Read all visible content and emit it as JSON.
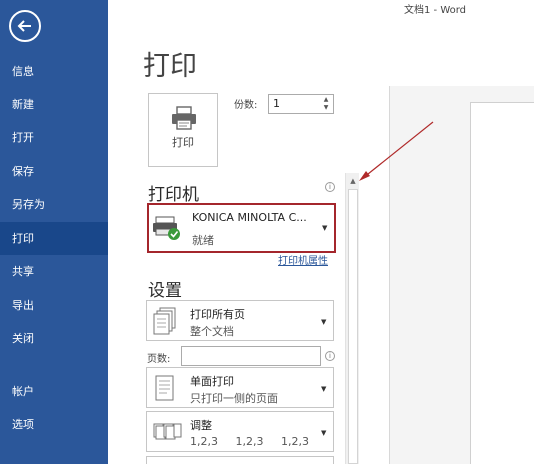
{
  "window": {
    "title": "文档1 - Word"
  },
  "sidebar": {
    "items": [
      {
        "label": "信息"
      },
      {
        "label": "新建"
      },
      {
        "label": "打开"
      },
      {
        "label": "保存"
      },
      {
        "label": "另存为"
      },
      {
        "label": "打印"
      },
      {
        "label": "共享"
      },
      {
        "label": "导出"
      },
      {
        "label": "关闭"
      },
      {
        "label": "帐户"
      },
      {
        "label": "选项"
      }
    ],
    "active": "打印",
    "color": "#2b579a"
  },
  "main": {
    "title": "打印",
    "print_button": {
      "label": "打印",
      "icon": "printer-icon"
    },
    "copies": {
      "label": "份数:",
      "value": "1"
    },
    "printer_section": {
      "heading": "打印机",
      "selected_name": "KONICA MINOLTA C...",
      "status": "就绪",
      "properties_link": "打印机属性",
      "highlight_color": "#a4262c"
    },
    "settings_section": {
      "heading": "设置",
      "range": {
        "main": "打印所有页",
        "sub": "整个文档"
      },
      "pages_label": "页数:",
      "pages_value": "",
      "sides": {
        "main": "单面打印",
        "sub": "只打印一侧的页面"
      },
      "collate": {
        "main": "调整",
        "sub": "1,2,3 1,2,3 1,2,3"
      }
    }
  },
  "icons": {
    "info": "i",
    "dropdown": "▼",
    "spin_up": "▲",
    "spin_down": "▼"
  }
}
